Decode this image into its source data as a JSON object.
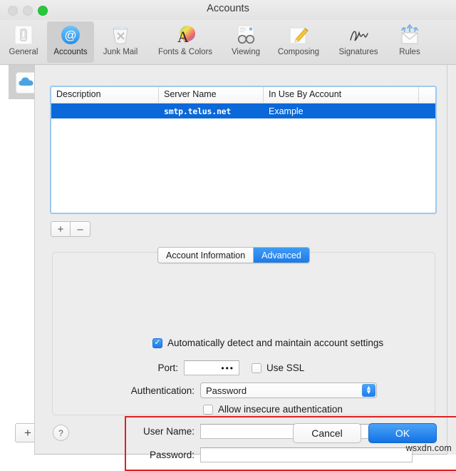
{
  "window": {
    "title": "Accounts",
    "controls": {
      "close": "close-button",
      "minimize": "minimize-button",
      "zoom": "zoom-button"
    }
  },
  "toolbar": {
    "items": [
      {
        "label": "General",
        "icon": "general-icon",
        "selected": false
      },
      {
        "label": "Accounts",
        "icon": "accounts-at-icon",
        "selected": true
      },
      {
        "label": "Junk Mail",
        "icon": "junk-mail-icon",
        "selected": false
      },
      {
        "label": "Fonts & Colors",
        "icon": "fonts-colors-icon",
        "selected": false
      },
      {
        "label": "Viewing",
        "icon": "viewing-glasses-icon",
        "selected": false
      },
      {
        "label": "Composing",
        "icon": "composing-pencil-icon",
        "selected": false
      },
      {
        "label": "Signatures",
        "icon": "signatures-icon",
        "selected": false
      },
      {
        "label": "Rules",
        "icon": "rules-icon",
        "selected": false
      }
    ]
  },
  "background": {
    "account_icon": "icloud-icon",
    "add_account_label": "+"
  },
  "sheet": {
    "table": {
      "columns": [
        "Description",
        "Server Name",
        "In Use By Account",
        ""
      ],
      "rows": [
        {
          "description": "",
          "server_name": "smtp.telus.net",
          "in_use_by_account": "Example",
          "extra": "",
          "selected": true
        }
      ]
    },
    "list_buttons": {
      "add": "+",
      "remove": "–"
    },
    "tabs": [
      {
        "label": "Account Information",
        "active": false
      },
      {
        "label": "Advanced",
        "active": true
      }
    ],
    "form": {
      "auto_detect": {
        "label": "Automatically detect and maintain account settings",
        "checked": true
      },
      "port": {
        "label": "Port:",
        "value": "•••"
      },
      "use_ssl": {
        "label": "Use SSL",
        "checked": false
      },
      "authentication": {
        "label": "Authentication:",
        "value": "Password",
        "arrows_icon": "chevron-up-down-icon"
      },
      "allow_insecure": {
        "label": "Allow insecure authentication",
        "checked": false
      },
      "user_name": {
        "label": "User Name:",
        "value": ""
      },
      "password": {
        "label": "Password:",
        "value": ""
      }
    },
    "annotation": {
      "color": "#e02020"
    },
    "footer": {
      "help_label": "?",
      "cancel_label": "Cancel",
      "ok_label": "OK"
    }
  },
  "watermark": "wsxdn.com",
  "colors": {
    "selection_blue": "#0a68d8",
    "accent_blue": "#1d7ae8",
    "annotation_red": "#e02020",
    "window_chrome": "#ececec"
  }
}
